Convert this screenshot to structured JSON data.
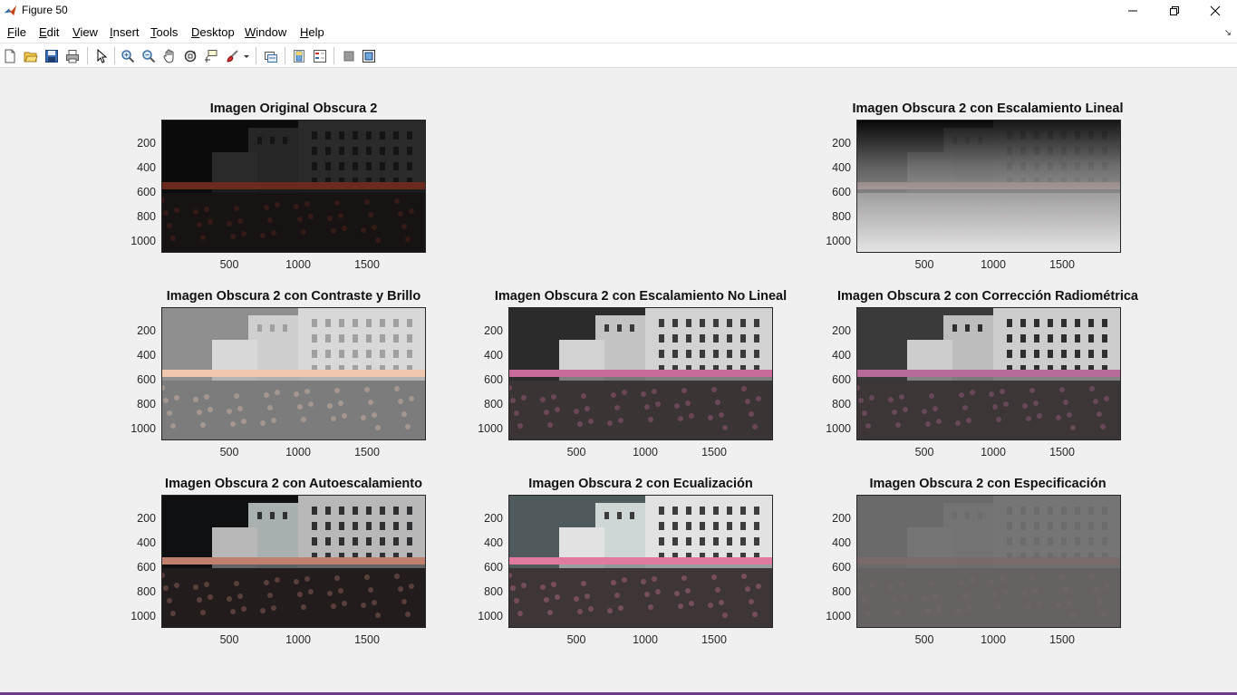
{
  "window": {
    "title": "Figure 50"
  },
  "menu": [
    {
      "label": "File",
      "u": "F",
      "rest": "ile"
    },
    {
      "label": "Edit",
      "u": "E",
      "rest": "dit"
    },
    {
      "label": "View",
      "u": "V",
      "rest": "iew"
    },
    {
      "label": "Insert",
      "u": "I",
      "rest": "nsert"
    },
    {
      "label": "Tools",
      "u": "T",
      "rest": "ools"
    },
    {
      "label": "Desktop",
      "u": "D",
      "rest": "esktop"
    },
    {
      "label": "Window",
      "u": "W",
      "rest": "indow"
    },
    {
      "label": "Help",
      "u": "H",
      "rest": "elp"
    }
  ],
  "toolbar": {
    "icons": [
      "new-figure-icon",
      "open-file-icon",
      "save-icon",
      "print-icon",
      "edit-plot-icon",
      "zoom-in-icon",
      "zoom-out-icon",
      "pan-icon",
      "rotate-3d-icon",
      "data-cursor-icon",
      "brush-icon",
      "brush-dropdown-icon",
      "link-plot-icon",
      "colorbar-icon",
      "legend-icon",
      "hide-plot-tools-icon",
      "show-plot-tools-icon"
    ]
  },
  "axis_ticks": {
    "y": [
      "200",
      "400",
      "600",
      "800",
      "1000"
    ],
    "x": [
      "500",
      "1000",
      "1500"
    ]
  },
  "panels": [
    {
      "id": "p1",
      "title": "Imagen Original Obscura 2",
      "mode": "dark"
    },
    {
      "id": "p3",
      "title": "Imagen Obscura 2 con Escalamiento Lineal",
      "mode": "linear"
    },
    {
      "id": "p4",
      "title": "Imagen Obscura 2 con Contraste y Brillo",
      "mode": "bright"
    },
    {
      "id": "p5",
      "title": "Imagen Obscura 2 con Escalamiento No Lineal",
      "mode": "nonlinear"
    },
    {
      "id": "p6",
      "title": "Imagen Obscura 2 con Corrección Radiométrica",
      "mode": "radiometric"
    },
    {
      "id": "p7",
      "title": "Imagen Obscura 2 con Autoescalamiento",
      "mode": "auto"
    },
    {
      "id": "p8",
      "title": "Imagen Obscura 2 con Ecualización",
      "mode": "equalized"
    },
    {
      "id": "p9",
      "title": "Imagen Obscura 2 con Especificación",
      "mode": "specified"
    }
  ]
}
